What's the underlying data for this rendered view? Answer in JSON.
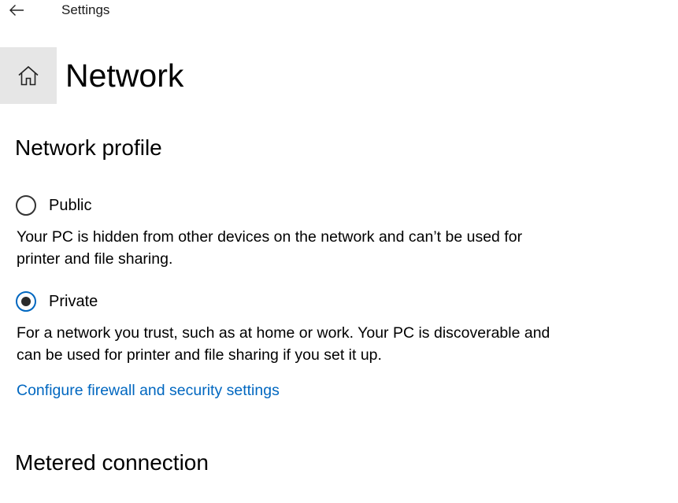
{
  "titlebar": {
    "back_icon": "arrow-left-icon",
    "title": "Settings"
  },
  "header": {
    "home_icon": "home-icon",
    "title": "Network"
  },
  "network_profile": {
    "heading": "Network profile",
    "options": [
      {
        "label": "Public",
        "checked": false,
        "description": "Your PC is hidden from other devices on the network and can’t be used for printer and file sharing."
      },
      {
        "label": "Private",
        "checked": true,
        "description": "For a network you trust, such as at home or work. Your PC is discoverable and can be used for printer and file sharing if you set it up."
      }
    ],
    "link": "Configure firewall and security settings"
  },
  "metered": {
    "heading": "Metered connection"
  },
  "colors": {
    "accent": "#0067c0",
    "home_button_bg": "#e6e6e6"
  }
}
